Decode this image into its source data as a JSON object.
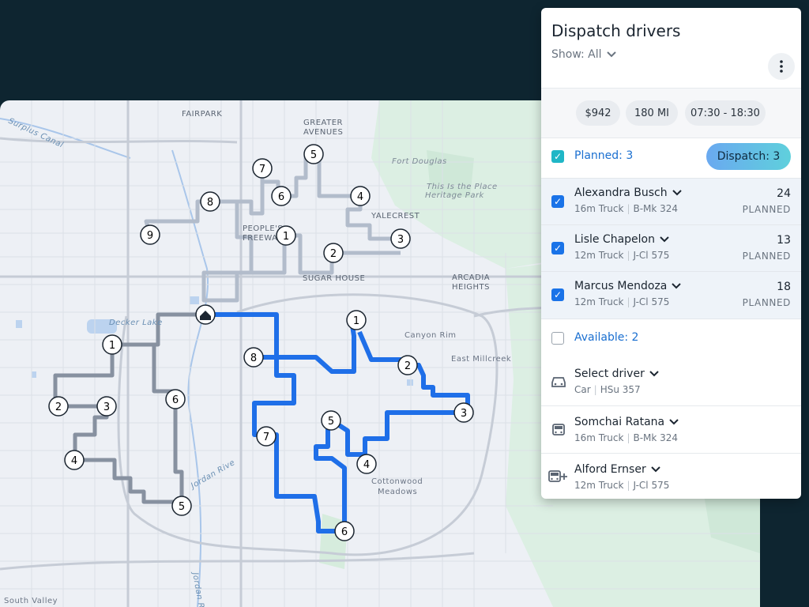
{
  "panel": {
    "title": "Dispatch drivers",
    "show_label": "Show: All",
    "stats": {
      "cost": "$942",
      "distance": "180 MI",
      "time_window": "07:30 - 18:30"
    },
    "planned": {
      "label": "Planned: 3",
      "dispatch_button": "Dispatch: 3",
      "drivers": [
        {
          "name": "Alexandra Busch",
          "vehicle": "16m Truck",
          "plate": "B-Mk 324",
          "count": "24",
          "status": "PLANNED",
          "checked": true
        },
        {
          "name": "Lisle Chapelon",
          "vehicle": "12m Truck",
          "plate": "J-Cl 575",
          "count": "13",
          "status": "PLANNED",
          "checked": true
        },
        {
          "name": "Marcus Mendoza",
          "vehicle": "12m Truck",
          "plate": "J-Cl 575",
          "count": "18",
          "status": "PLANNED",
          "checked": true
        }
      ]
    },
    "available": {
      "label": "Available: 2",
      "drivers": [
        {
          "name": "Select driver",
          "vehicle": "Car",
          "plate": "HSu 357",
          "icon": "car-icon"
        },
        {
          "name": "Somchai Ratana",
          "vehicle": "16m Truck",
          "plate": "B-Mk 324",
          "icon": "truck-icon"
        },
        {
          "name": "Alford Ernser",
          "vehicle": "12m Truck",
          "plate": "J-Cl 575",
          "icon": "truck-add-icon"
        }
      ]
    }
  },
  "map": {
    "labels": {
      "fairpark": "FAIRPARK",
      "greater_avenues_1": "GREATER",
      "greater_avenues_2": "AVENUES",
      "fort_douglas": "Fort Douglas",
      "this_is_place_1": "This Is the Place",
      "this_is_place_2": "Heritage Park",
      "yalecrest": "YALECREST",
      "peoples_freeway_1": "PEOPLE'S",
      "peoples_freeway_2": "FREEWAY",
      "sugar_house": "SUGAR HOUSE",
      "arcadia_heights_1": "ARCADIA",
      "arcadia_heights_2": "HEIGHTS",
      "decker_lake": "Decker Lake",
      "canyon_rim": "Canyon Rim",
      "east_millcreek": "East Millcreek",
      "cottonwood_meadows_1": "Cottonwood",
      "cottonwood_meadows_2": "Meadows",
      "surplus_canal": "Surplus Canal",
      "jordan_river": "Jordan Rive",
      "jordan_river_2": "Jordan Rive",
      "south_valley": "South Valley"
    },
    "route_colors": {
      "planned_blue": "#1f6fe8",
      "gray_route": "#8791a0",
      "light_route": "#b2bccb"
    },
    "stops": {
      "blue": [
        "1",
        "2",
        "3",
        "4",
        "5",
        "6",
        "7",
        "8"
      ],
      "gray": [
        "1",
        "2",
        "3",
        "4",
        "5",
        "6"
      ],
      "light": [
        "1",
        "2",
        "3",
        "4",
        "5",
        "6",
        "7",
        "8",
        "9"
      ]
    },
    "depot_icon": "home-icon"
  }
}
